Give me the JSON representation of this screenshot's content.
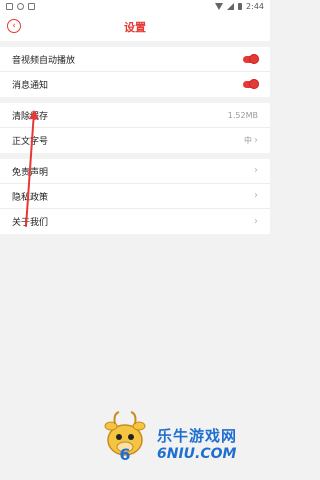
{
  "status_bar": {
    "time": "2:44"
  },
  "header": {
    "title": "设置"
  },
  "groups": [
    {
      "rows": [
        {
          "label": "音视频自动播放",
          "toggle_on": true
        },
        {
          "label": "消息通知",
          "toggle_on": true
        }
      ]
    },
    {
      "rows": [
        {
          "label": "清除缓存",
          "value": "1.52MB"
        },
        {
          "label": "正文字号",
          "value": "中"
        }
      ]
    },
    {
      "rows": [
        {
          "label": "免责声明"
        },
        {
          "label": "隐私政策"
        },
        {
          "label": "关于我们"
        }
      ]
    }
  ],
  "watermark": {
    "cn": "乐牛游戏网",
    "en": "6NIU.COM"
  },
  "colors": {
    "accent": "#e53935",
    "watermark": "#1f6fd1"
  }
}
